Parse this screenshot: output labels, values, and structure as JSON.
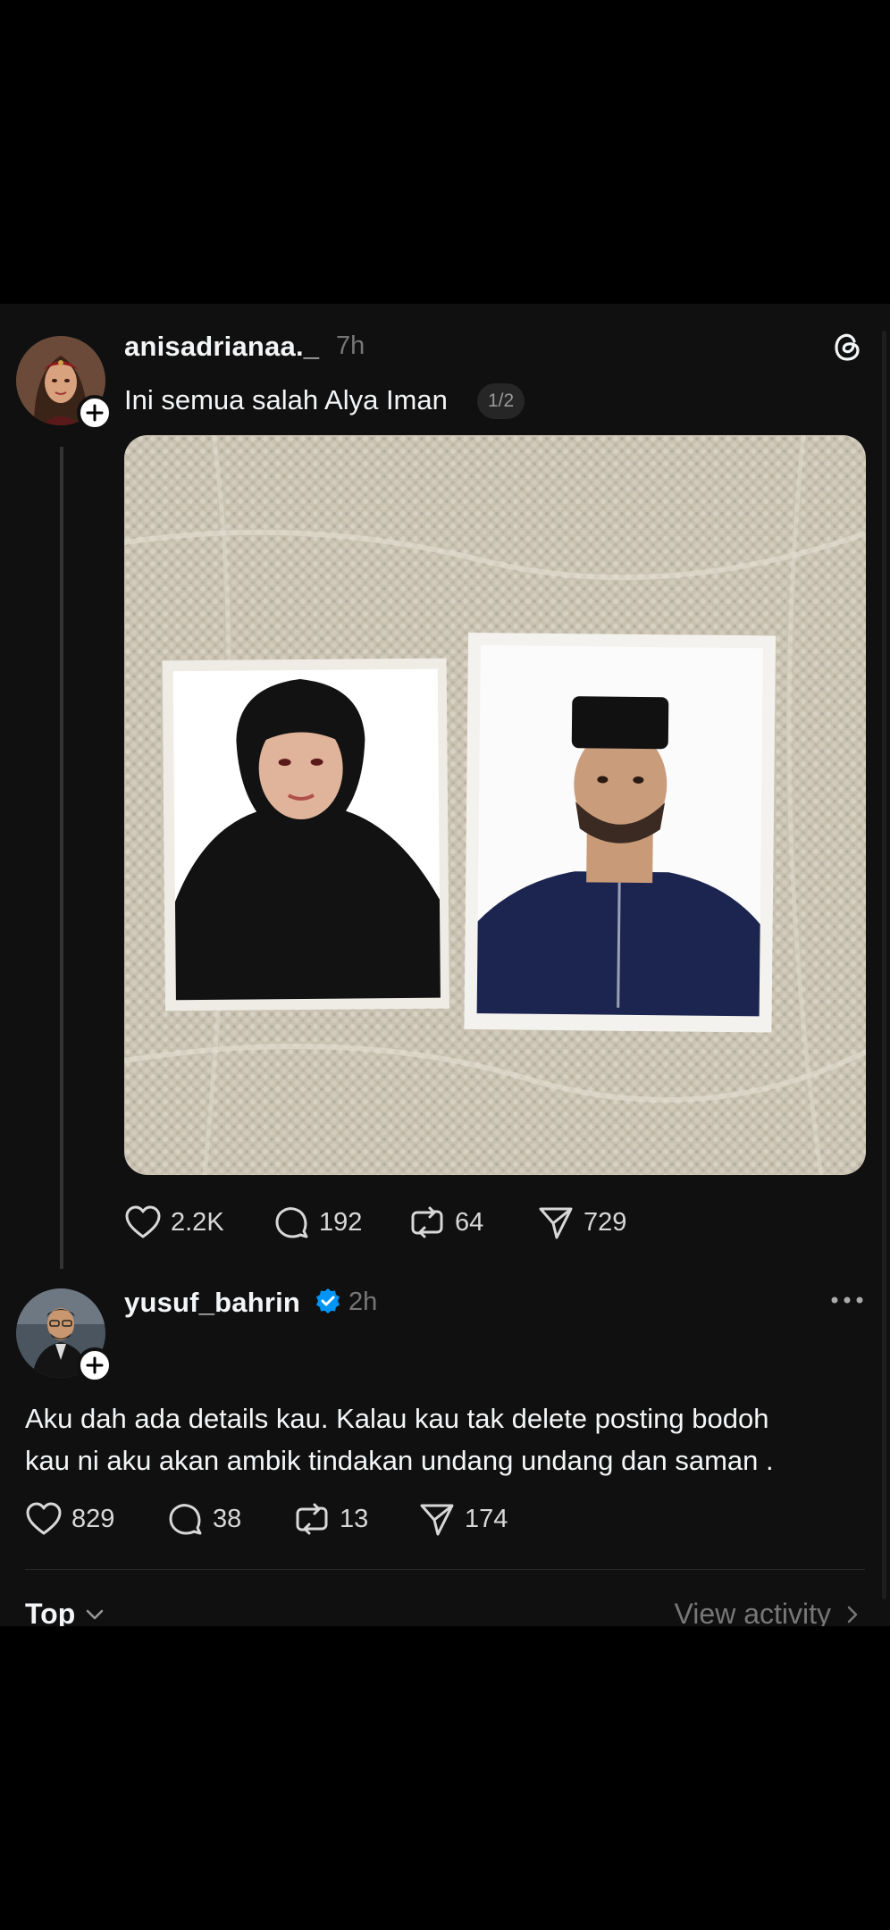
{
  "post1": {
    "username": "anisadrianaa._",
    "time": "7h",
    "text": "Ini semua salah Alya Iman",
    "media_counter": "1/2",
    "likes": "2.2K",
    "replies": "192",
    "reposts": "64",
    "shares": "729"
  },
  "post2": {
    "username": "yusuf_bahrin",
    "time": "2h",
    "verified": true,
    "text_line1": "Aku dah ada details kau. Kalau kau tak delete posting bodoh",
    "text_line2": "kau ni aku akan ambik tindakan undang undang dan saman .",
    "likes": "829",
    "replies": "38",
    "reposts": "13",
    "shares": "174"
  },
  "footer": {
    "sort_label": "Top",
    "view_activity": "View activity"
  },
  "colors": {
    "background": "#101010",
    "verified": "#0095f6",
    "muted": "#777777"
  }
}
